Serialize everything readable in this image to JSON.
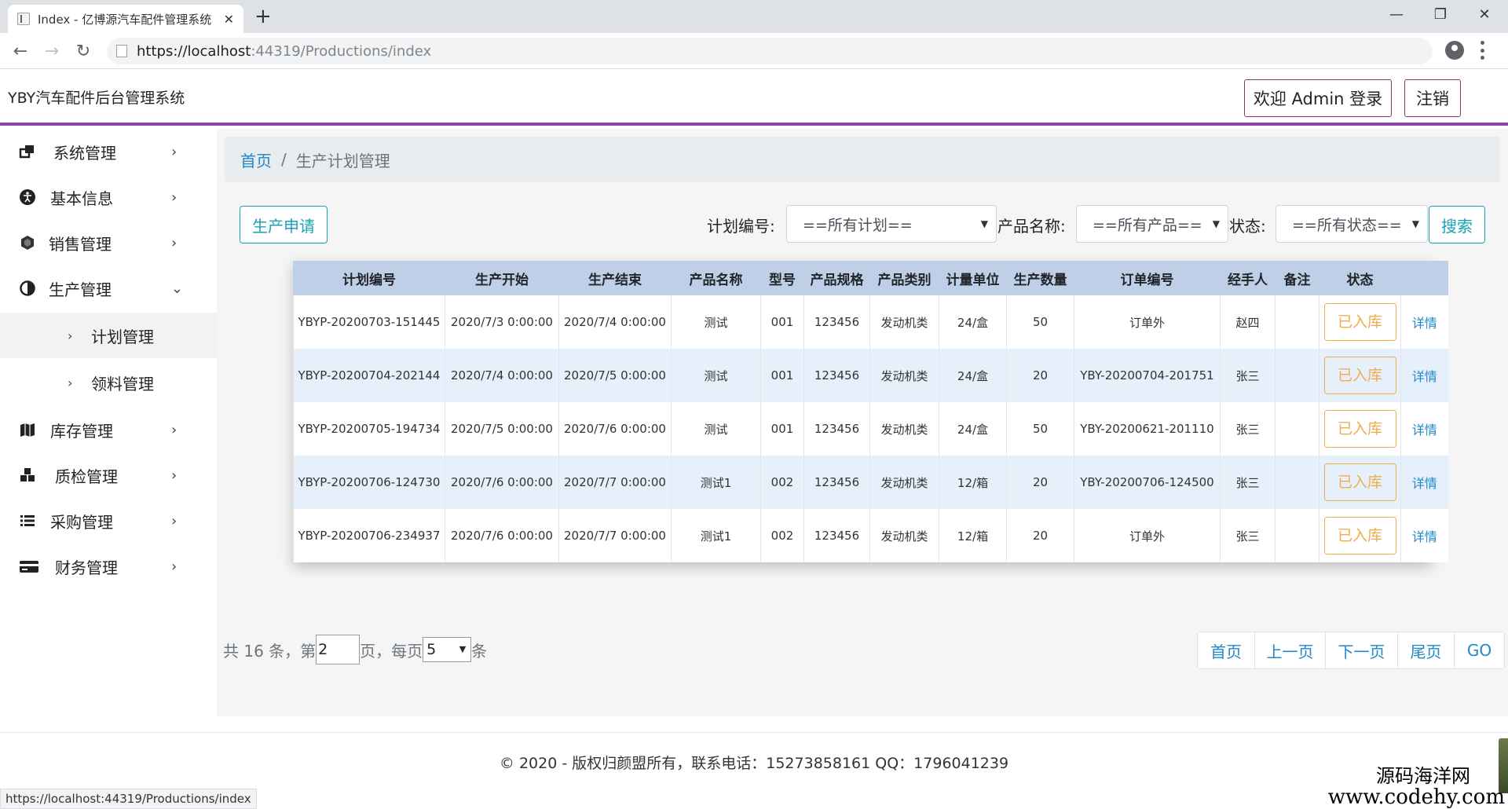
{
  "browser": {
    "tab_title": "Index - 亿博源汽车配件管理系统",
    "tab_close": "✕",
    "new_tab": "+",
    "url_host": "https://localhost",
    "url_rest": ":44319/Productions/index",
    "minimize": "—",
    "restore": "❐",
    "close": "✕",
    "back": "←",
    "forward": "→",
    "reload": "↻"
  },
  "header": {
    "brand": "YBY汽车配件后台管理系统",
    "welcome_button": "欢迎 Admin 登录",
    "logout_button": "注销"
  },
  "sidebar": {
    "items": [
      {
        "label": "系统管理",
        "icon": "windows-icon",
        "chevron": "›"
      },
      {
        "label": "基本信息",
        "icon": "accessibility-icon",
        "chevron": "›"
      },
      {
        "label": "销售管理",
        "icon": "hexagon-icon",
        "chevron": "›"
      },
      {
        "label": "生产管理",
        "icon": "half-circle-icon",
        "chevron": "⌄"
      },
      {
        "label": "库存管理",
        "icon": "map-icon",
        "chevron": "›"
      },
      {
        "label": "质检管理",
        "icon": "cubes-icon",
        "chevron": "›"
      },
      {
        "label": "采购管理",
        "icon": "list-icon",
        "chevron": "›"
      },
      {
        "label": "财务管理",
        "icon": "credit-card-icon",
        "chevron": "›"
      }
    ],
    "sub_items": [
      {
        "label": "计划管理",
        "chevron": "›"
      },
      {
        "label": "领料管理",
        "chevron": "›"
      }
    ]
  },
  "breadcrumb": {
    "home": "首页",
    "separator": "/",
    "current": "生产计划管理"
  },
  "toolbar": {
    "apply_button": "生产申请",
    "plan_label": "计划编号:",
    "plan_select": "==所有计划==",
    "product_label": "产品名称:",
    "product_select": "==所有产品==",
    "status_label": "状态:",
    "status_select": "==所有状态==",
    "search_button": "搜索"
  },
  "table": {
    "headers": [
      "计划编号",
      "生产开始",
      "生产结束",
      "产品名称",
      "型号",
      "产品规格",
      "产品类别",
      "计量单位",
      "生产数量",
      "订单编号",
      "经手人",
      "备注",
      "状态",
      ""
    ],
    "rows": [
      [
        "YBYP-20200703-151445",
        "2020/7/3 0:00:00",
        "2020/7/4 0:00:00",
        "测试",
        "001",
        "123456",
        "发动机类",
        "24/盒",
        "50",
        "订单外",
        "赵四",
        "",
        "已入库",
        "详情"
      ],
      [
        "YBYP-20200704-202144",
        "2020/7/4 0:00:00",
        "2020/7/5 0:00:00",
        "测试",
        "001",
        "123456",
        "发动机类",
        "24/盒",
        "20",
        "YBY-20200704-201751",
        "张三",
        "",
        "已入库",
        "详情"
      ],
      [
        "YBYP-20200705-194734",
        "2020/7/5 0:00:00",
        "2020/7/6 0:00:00",
        "测试",
        "001",
        "123456",
        "发动机类",
        "24/盒",
        "50",
        "YBY-20200621-201110",
        "张三",
        "",
        "已入库",
        "详情"
      ],
      [
        "YBYP-20200706-124730",
        "2020/7/6 0:00:00",
        "2020/7/7 0:00:00",
        "测试1",
        "002",
        "123456",
        "发动机类",
        "12/箱",
        "20",
        "YBY-20200706-124500",
        "张三",
        "",
        "已入库",
        "详情"
      ],
      [
        "YBYP-20200706-234937",
        "2020/7/6 0:00:00",
        "2020/7/7 0:00:00",
        "测试1",
        "002",
        "123456",
        "发动机类",
        "12/箱",
        "20",
        "订单外",
        "张三",
        "",
        "已入库",
        "详情"
      ]
    ]
  },
  "pagination": {
    "total_prefix": "共 16 条，第",
    "page_value": "2",
    "page_suffix": "页，每页",
    "page_size": "5",
    "size_suffix": "条",
    "first": "首页",
    "prev": "上一页",
    "next": "下一页",
    "last": "尾页",
    "go": "GO"
  },
  "footer": {
    "text": "© 2020 - 版权归颜盟所有，联系电话：15273858161 QQ：1796041239",
    "status_url": "https://localhost:44319/Productions/index",
    "watermark_line1": "源码海洋网",
    "watermark_line2": "www.codehy.com"
  },
  "colors": {
    "accent_purple": "#8e44ad",
    "link_blue": "#1e88c8",
    "status_orange": "#f0ad4e",
    "table_header": "#bfcfe8",
    "row_highlight": "#e6f0fb",
    "teal_button": "#17a2b8"
  }
}
